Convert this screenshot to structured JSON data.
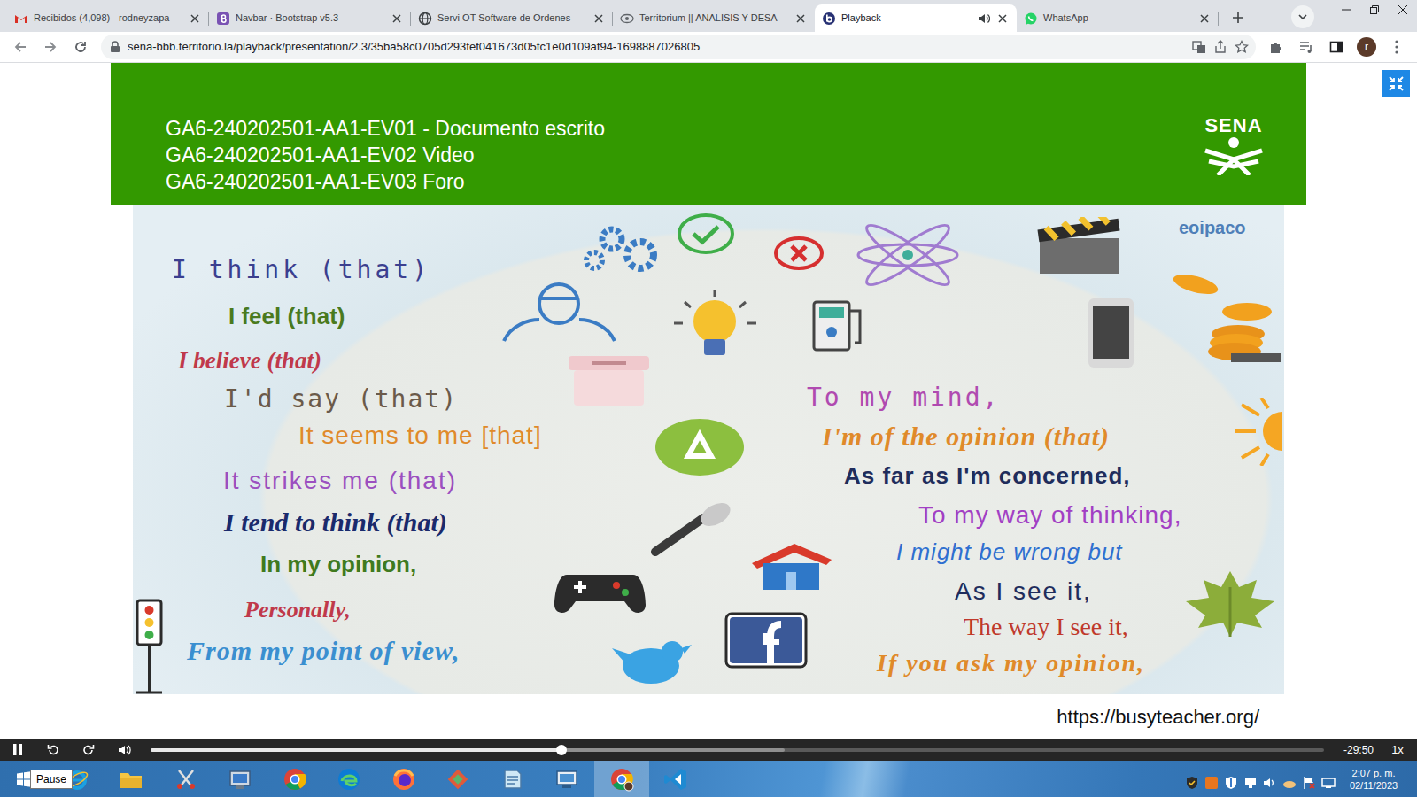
{
  "browser": {
    "tabs": [
      {
        "label": "Recibidos (4,098) - rodneyzapa",
        "selected": false,
        "audio": false
      },
      {
        "label": "Navbar · Bootstrap v5.3",
        "selected": false,
        "audio": false
      },
      {
        "label": "Servi OT Software de Ordenes",
        "selected": false,
        "audio": false
      },
      {
        "label": "Territorium || ANALISIS Y DESA",
        "selected": false,
        "audio": false
      },
      {
        "label": "Playback",
        "selected": true,
        "audio": true
      },
      {
        "label": "WhatsApp",
        "selected": false,
        "audio": false
      }
    ],
    "url": "sena-bbb.territorio.la/playback/presentation/2.3/35ba58c0705d293fef041673d05fc1e0d109af94-1698887026805",
    "profile": "r"
  },
  "slide": {
    "heading_lines": [
      "GA6-240202501-AA1-EV01 - Documento escrito",
      "GA6-240202501-AA1-EV02 Video",
      "GA6-240202501-AA1-EV03 Foro"
    ],
    "logo": "SENA",
    "watermark": "eoipaco",
    "phrases_left": [
      {
        "text": "I think (that)",
        "color": "#3b3f8f"
      },
      {
        "text": "I feel (that)",
        "color": "#4a7a1e"
      },
      {
        "text": "I believe (that)",
        "color": "#c0394b"
      },
      {
        "text": "I'd say (that)",
        "color": "#6b5a4a"
      },
      {
        "text": "It seems to me [that]",
        "color": "#e08a2a"
      },
      {
        "text": "It strikes me (that)",
        "color": "#9b4fc0"
      },
      {
        "text": "I tend to think (that)",
        "color": "#1a2a6c"
      },
      {
        "text": "In my opinion,",
        "color": "#3f7a1e"
      },
      {
        "text": "Personally,",
        "color": "#c0394b"
      },
      {
        "text": "From my point of view,",
        "color": "#3a8fd0"
      }
    ],
    "phrases_right": [
      {
        "text": "To my mind,",
        "color": "#b04ab0"
      },
      {
        "text": "I'm of the opinion (that)",
        "color": "#e08a2a"
      },
      {
        "text": "As far as I'm concerned,",
        "color": "#1f2d5c"
      },
      {
        "text": "To my way of thinking,",
        "color": "#a23fc4"
      },
      {
        "text": "I might be wrong but",
        "color": "#2f6fd0"
      },
      {
        "text": "As I see it,",
        "color": "#1f2d5c"
      },
      {
        "text": "The way I see it,",
        "color": "#c0392b"
      },
      {
        "text": "If you ask my opinion,",
        "color": "#e08a2a"
      }
    ],
    "source": "https://busyteacher.org/"
  },
  "player": {
    "playing": true,
    "tooltip": "Pause",
    "level": 0.35,
    "buffered": 0.54,
    "time": "-29:50",
    "speed": "1x"
  },
  "taskbar": {
    "apps": [
      {
        "selected": false
      },
      {
        "selected": false
      },
      {
        "selected": false
      },
      {
        "selected": false
      },
      {
        "selected": false
      },
      {
        "selected": false
      },
      {
        "selected": false
      },
      {
        "selected": false
      },
      {
        "selected": false
      },
      {
        "selected": false
      },
      {
        "selected": true
      },
      {
        "selected": false
      }
    ],
    "time": "2:07 p. m.",
    "date": "02/11/2023"
  }
}
